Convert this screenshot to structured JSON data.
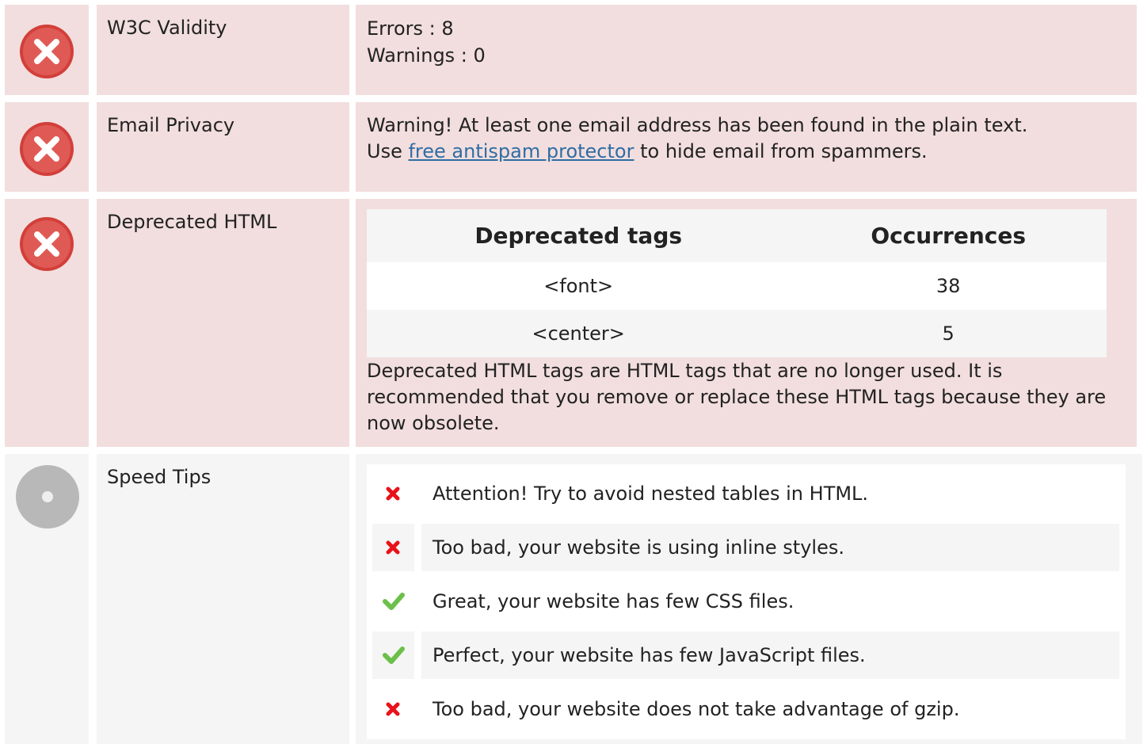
{
  "rows": {
    "w3c": {
      "label": "W3C Validity",
      "errors": "Errors : 8",
      "warnings": "Warnings : 0"
    },
    "email": {
      "label": "Email Privacy",
      "line1": "Warning! At least one email address has been found in the plain text.",
      "line2_prefix": "Use ",
      "link": "free antispam protector",
      "line2_suffix": " to hide email from spammers."
    },
    "deprecated": {
      "label": "Deprecated HTML",
      "col_tag": "Deprecated tags",
      "col_occ": "Occurrences",
      "rows": [
        {
          "tag": "<font>",
          "count": "38"
        },
        {
          "tag": "<center>",
          "count": "5"
        }
      ],
      "description": "Deprecated HTML tags are HTML tags that are no longer used. It is recommended that you remove or replace these HTML tags because they are now obsolete."
    },
    "speed": {
      "label": "Speed Tips",
      "tips": [
        {
          "text": "Attention! Try to avoid nested tables in HTML.",
          "icon": "cross-icon"
        },
        {
          "text": "Too bad, your website is using inline styles.",
          "icon": "cross-icon"
        },
        {
          "text": "Great, your website has few CSS files.",
          "icon": "check-icon"
        },
        {
          "text": "Perfect, your website has few JavaScript files.",
          "icon": "check-icon"
        },
        {
          "text": "Too bad, your website does not take advantage of gzip.",
          "icon": "cross-icon"
        }
      ]
    }
  },
  "colors": {
    "error_bg": "#f2dede",
    "neutral_bg": "#f5f5f5",
    "error_icon": "#d9534f",
    "ok_icon": "#5cb85c",
    "link": "#2e6da4"
  }
}
